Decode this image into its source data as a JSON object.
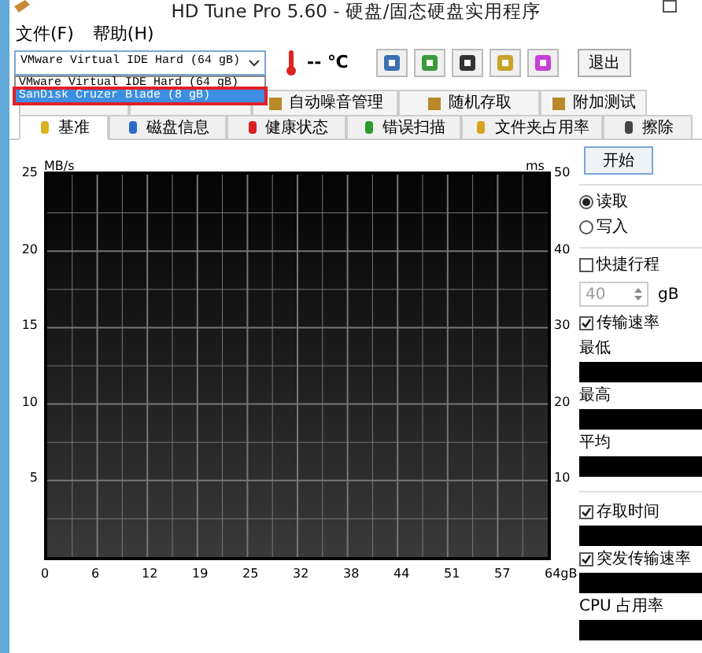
{
  "window": {
    "title": "HD Tune Pro 5.60 - 硬盘/固态硬盘实用程序"
  },
  "menu": [
    "文件(F)",
    "帮助(H)"
  ],
  "toolbar": {
    "drive": "VMware Virtual IDE Hard (64 gB)",
    "temperature": "-- ℃",
    "exit": "退出"
  },
  "drive_list": [
    {
      "label": "VMware Virtual IDE Hard (64 gB)",
      "selected": false
    },
    {
      "label": "SanDisk Cruzer Blade (8 gB)",
      "selected": true
    }
  ],
  "upper_tabs": [
    {
      "label": "自动噪音管理"
    },
    {
      "label": "随机存取"
    },
    {
      "label": "附加测试"
    }
  ],
  "tabs": [
    {
      "label": "基准",
      "selected": true
    },
    {
      "label": "磁盘信息",
      "selected": false
    },
    {
      "label": "健康状态",
      "selected": false
    },
    {
      "label": "错误扫描",
      "selected": false
    },
    {
      "label": "文件夹占用率",
      "selected": false
    },
    {
      "label": "擦除",
      "selected": false
    }
  ],
  "chart": {
    "left_unit": "MB/s",
    "right_unit": "ms",
    "left_ticks": [
      "25",
      "20",
      "15",
      "10",
      "5"
    ],
    "right_ticks": [
      "50",
      "40",
      "30",
      "20",
      "10"
    ],
    "x_ticks": [
      "0",
      "6",
      "12",
      "19",
      "25",
      "32",
      "38",
      "44",
      "51",
      "57",
      "64gB"
    ]
  },
  "panel": {
    "start": "开始",
    "modes": [
      {
        "label": "读取",
        "selected": true
      },
      {
        "label": "写入",
        "selected": false
      }
    ],
    "short_stroke": {
      "label": "快捷行程",
      "checked": false
    },
    "size": "40",
    "size_unit": "gB",
    "transfer": {
      "label": "传输速率",
      "checked": true
    },
    "stats": [
      "最低",
      "最高",
      "平均"
    ],
    "access": {
      "label": "存取时间",
      "checked": true
    },
    "burst": {
      "label": "突发传输速率",
      "checked": true
    },
    "cpu": "CPU 占用率"
  }
}
